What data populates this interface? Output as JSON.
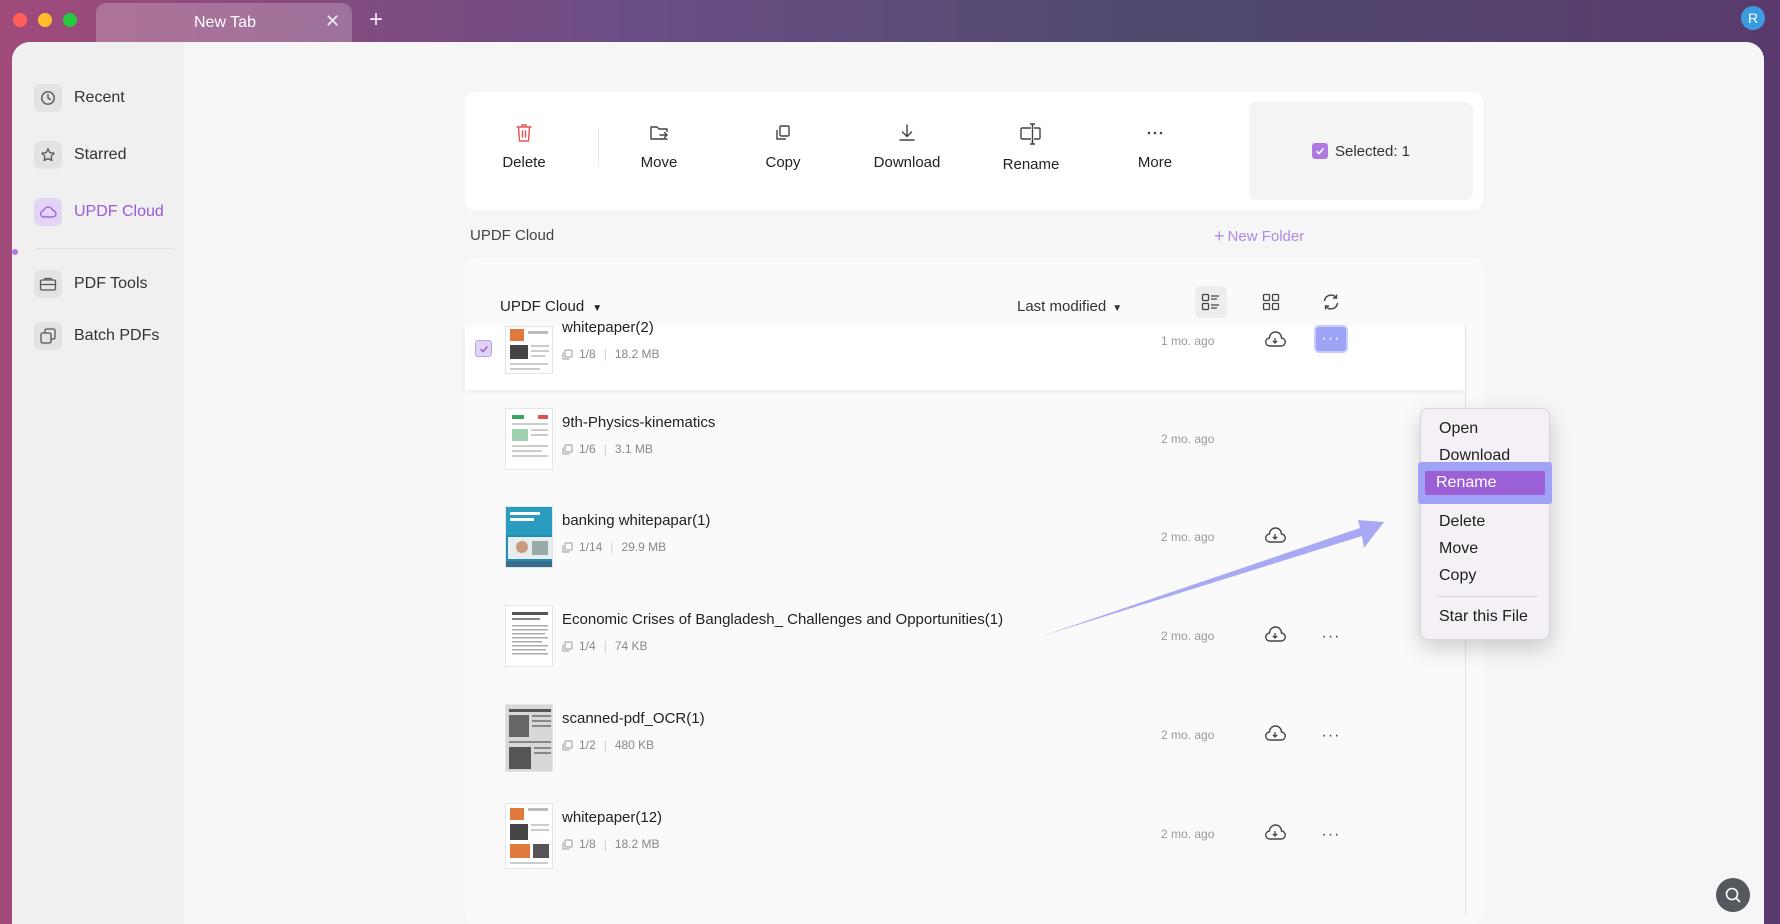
{
  "window": {
    "tab_title": "New Tab",
    "user_initial": "R"
  },
  "sidebar": {
    "items": [
      {
        "label": "Recent",
        "icon": "clock-icon"
      },
      {
        "label": "Starred",
        "icon": "star-icon"
      },
      {
        "label": "UPDF Cloud",
        "icon": "cloud-icon",
        "active": true
      },
      {
        "label": "PDF Tools",
        "icon": "briefcase-icon"
      },
      {
        "label": "Batch PDFs",
        "icon": "batch-files-icon"
      }
    ]
  },
  "toolbar": {
    "delete_label": "Delete",
    "move_label": "Move",
    "copy_label": "Copy",
    "download_label": "Download",
    "rename_label": "Rename",
    "more_label": "More",
    "selected_label": "Selected: 1"
  },
  "content": {
    "breadcrumb": "UPDF Cloud",
    "new_folder_label": "New Folder",
    "folder_dropdown": "UPDF Cloud",
    "sort_label": "Last modified"
  },
  "files": [
    {
      "name": "whitepaper(2)",
      "pages": "1/8",
      "size": "18.2 MB",
      "date": "1 mo. ago",
      "selected": true
    },
    {
      "name": "9th-Physics-kinematics",
      "pages": "1/6",
      "size": "3.1 MB",
      "date": "2 mo. ago"
    },
    {
      "name": "banking whitepapar(1)",
      "pages": "1/14",
      "size": "29.9 MB",
      "date": "2 mo. ago"
    },
    {
      "name": "Economic Crises of Bangladesh_ Challenges and Opportunities(1)",
      "pages": "1/4",
      "size": "74 KB",
      "date": "2 mo. ago"
    },
    {
      "name": "scanned-pdf_OCR(1)",
      "pages": "1/2",
      "size": "480 KB",
      "date": "2 mo. ago"
    },
    {
      "name": "whitepaper(12)",
      "pages": "1/8",
      "size": "18.2 MB",
      "date": "2 mo. ago"
    }
  ],
  "context_menu": {
    "items": [
      "Open",
      "Download",
      "Rename",
      "Delete",
      "Move",
      "Copy",
      "Star this File"
    ],
    "highlighted": "Rename"
  },
  "colors": {
    "accent": "#9b5fd6",
    "highlight_outline": "#a0a2f5",
    "arrow": "#a8a8f5"
  }
}
